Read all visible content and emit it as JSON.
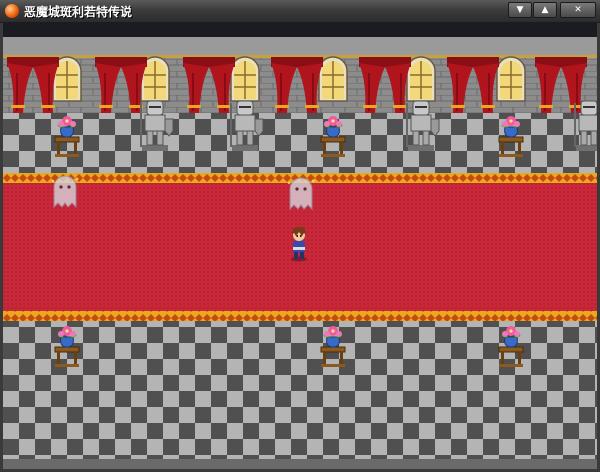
{
  "window": {
    "title": "恶魔城斑利若特传说",
    "controls": {
      "minimize_glyph": "▼",
      "maximize_glyph": "▲",
      "close_glyph": "✕"
    }
  },
  "scene": {
    "type": "rpg-castle-hall",
    "colors": {
      "wall_stone": "#8c8c8c",
      "floor_light": "#b4b4b4",
      "floor_dark": "#505050",
      "carpet": "#c8283a",
      "carpet_border": "#e8a820",
      "curtain": "#b0141c",
      "window_glass": "#f2d878"
    },
    "sprites": [
      "player-hero-icon",
      "ghost-icon",
      "knight-armor-statue-icon",
      "flower-vase-pedestal-icon"
    ]
  }
}
